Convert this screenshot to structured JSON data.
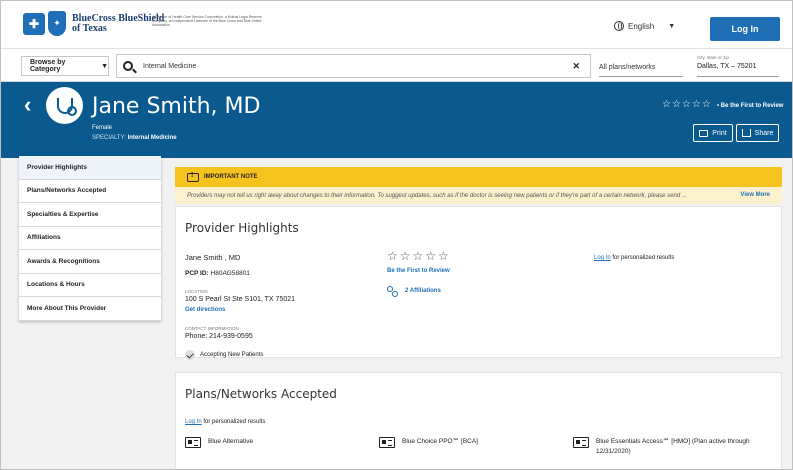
{
  "header": {
    "brand_line1": "BlueCross BlueShield",
    "brand_line2": "of Texas",
    "disclaimer": "A Division of Health Care Service Corporation, a Mutual Legal Reserve Company, an Independent Licensee of the Blue Cross and Blue Shield Association",
    "language": "English",
    "login_label": "Log In"
  },
  "search": {
    "browse_label": "Browse by Category",
    "query": "Internal Medicine",
    "plans_filter": "All plans/networks",
    "location_label": "City, state or zip",
    "location_value": "Dallas, TX – 75201"
  },
  "provider": {
    "name": "Jane Smith, MD",
    "gender": "Female",
    "specialty_label": "SPECIALTY:",
    "specialty_value": "Internal Medicine",
    "stars": "☆☆☆☆☆",
    "review_cta": "• Be the First to Review",
    "print_label": "Print",
    "share_label": "Share"
  },
  "sidebar": {
    "items": [
      {
        "label": "Provider Highlights"
      },
      {
        "label": "Plans/Networks Accepted"
      },
      {
        "label": "Specialties & Expertise"
      },
      {
        "label": "Affiliations"
      },
      {
        "label": "Awards & Recognitions"
      },
      {
        "label": "Locations & Hours"
      },
      {
        "label": "More About This Provider"
      }
    ]
  },
  "note": {
    "title": "IMPORTANT NOTE",
    "body": "Providers may not tell us right away about changes to their information. To suggest updates, such as if the doctor is seeing new patients or if they're part of a certain network, please send ...",
    "view_more": "View More"
  },
  "highlights": {
    "title": "Provider Highlights",
    "name": "Jane Smith , MD",
    "pcp_label": "PCP ID:",
    "pcp_value": "H80AG58801",
    "location_label": "LOCATION",
    "address": "100 S Pearl St Ste S101, TX 75021",
    "directions": "Get directions",
    "contact_label": "CONTACT INFORMATION",
    "phone": "Phone: 214-939-0595",
    "accepting": "Accepting New Patients",
    "stars": "☆☆☆☆☆",
    "review_cta": "Be the First to Review",
    "affiliations": "2 Affiliations",
    "login_link": "Log In",
    "login_suffix": " for personalized results"
  },
  "plans": {
    "title": "Plans/Networks Accepted",
    "login_link": "Log In",
    "login_suffix": " for personalized results",
    "items": [
      {
        "label": "Blue Alternative"
      },
      {
        "label": "Blue Choice PPO℠ [BCA]"
      },
      {
        "label": "Blue Essentials Access℠ [HMO] (Plan active through 12/31/2020)"
      }
    ]
  }
}
